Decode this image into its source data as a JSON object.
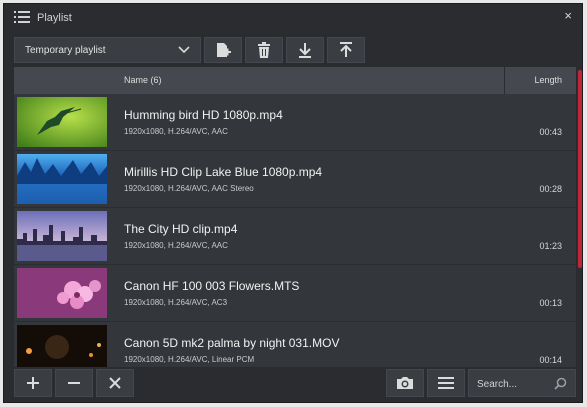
{
  "window": {
    "title": "Playlist",
    "close_glyph": "×"
  },
  "toolbar": {
    "playlist_select": "Temporary playlist",
    "buttons": [
      "add-file-icon",
      "trash-icon",
      "move-down-icon",
      "move-up-icon"
    ]
  },
  "header": {
    "name": "Name (6)",
    "length": "Length"
  },
  "items": [
    {
      "name": "Humming bird HD 1080p.mp4",
      "meta": "1920x1080, H.264/AVC, AAC",
      "duration": "00:43"
    },
    {
      "name": "Mirillis HD Clip Lake Blue 1080p.mp4",
      "meta": "1920x1080, H.264/AVC, AAC Stereo",
      "duration": "00:28"
    },
    {
      "name": "The City HD clip.mp4",
      "meta": "1920x1080, H.264/AVC, AAC",
      "duration": "01:23"
    },
    {
      "name": "Canon HF 100 003 Flowers.MTS",
      "meta": "1920x1080, H.264/AVC, AC3",
      "duration": "00:13"
    },
    {
      "name": "Canon 5D mk2 palma by night 031.MOV",
      "meta": "1920x1080, H.264/AVC, Linear PCM",
      "duration": "00:14"
    }
  ],
  "bottom": {
    "search_placeholder": "Search...",
    "buttons": [
      "plus-icon",
      "minus-icon",
      "x-icon",
      "camera-icon",
      "menu-icon"
    ]
  },
  "colors": {
    "accent": "#c0283a",
    "background": "#2a2c30",
    "row": "#33363b",
    "header": "#45484e"
  }
}
